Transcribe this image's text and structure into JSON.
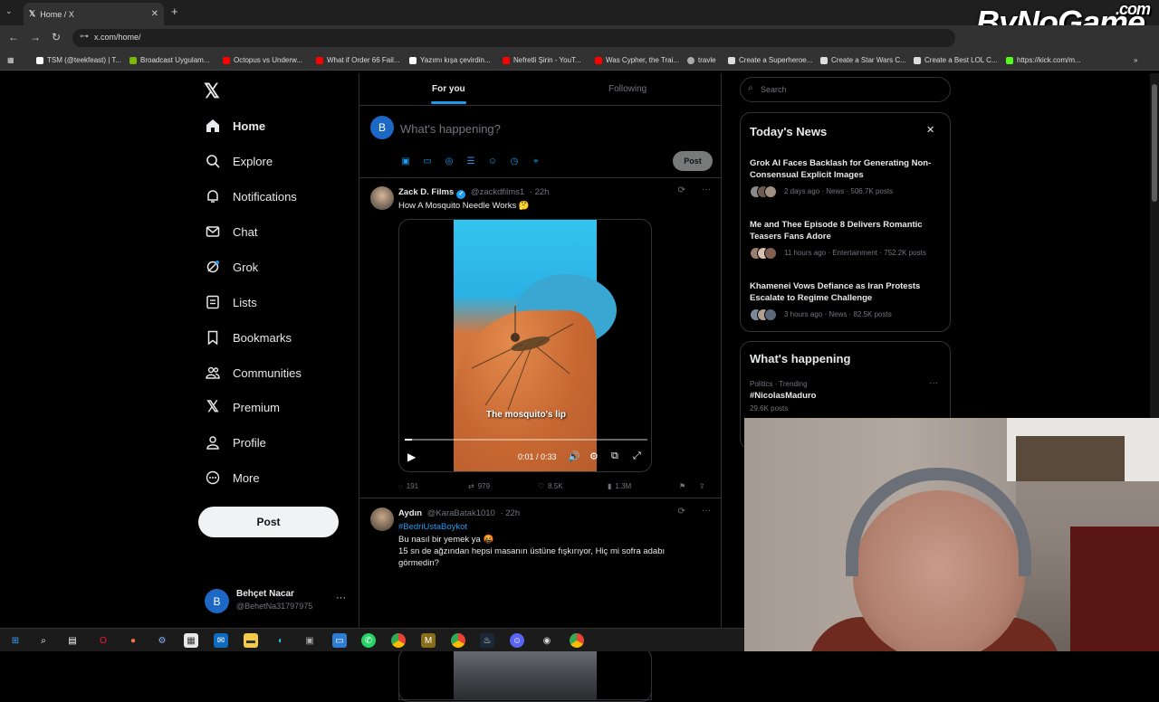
{
  "browser": {
    "tab_title": "Home / X",
    "url": "x.com/home/",
    "bookmarks": [
      "TSM (@teekfeast) | T...",
      "Broadcast Uygulam...",
      "Octopus vs Underw...",
      "What if Order 66 Fail...",
      "Yazımı kışa çevirdin...",
      "Nefretli Şirin - YouT...",
      "Was Cypher, the Trai...",
      "travle",
      "Create a Superheroe...",
      "Create a Star Wars C...",
      "Create a Best LOL C...",
      "https://kick.com/m..."
    ]
  },
  "overlay": {
    "logo": "ByNoGame",
    "logo_suffix": ".com"
  },
  "nav": {
    "items": [
      {
        "label": "Home",
        "icon": "home-icon"
      },
      {
        "label": "Explore",
        "icon": "search-icon"
      },
      {
        "label": "Notifications",
        "icon": "bell-icon"
      },
      {
        "label": "Chat",
        "icon": "mail-icon"
      },
      {
        "label": "Grok",
        "icon": "grok-icon"
      },
      {
        "label": "Lists",
        "icon": "list-icon"
      },
      {
        "label": "Bookmarks",
        "icon": "bookmark-icon"
      },
      {
        "label": "Communities",
        "icon": "people-icon"
      },
      {
        "label": "Premium",
        "icon": "x-icon"
      },
      {
        "label": "Profile",
        "icon": "person-icon"
      },
      {
        "label": "More",
        "icon": "more-circle-icon"
      }
    ],
    "post_label": "Post",
    "account": {
      "initial": "B",
      "name": "Behçet Nacar",
      "handle": "@BehetNa31797975"
    }
  },
  "feed": {
    "tabs": [
      "For you",
      "Following"
    ],
    "compose": {
      "initial": "B",
      "placeholder": "What's happening?",
      "post_label": "Post"
    },
    "tweets": [
      {
        "name": "Zack D. Films",
        "handle": "@zackdfilms1",
        "time": "· 22h",
        "text": "How A Mosquito Needle Works 🤔",
        "video": {
          "caption": "The mosquito's lip",
          "time": "0:01 / 0:33",
          "progress": 0.03
        },
        "replies": "191",
        "reposts": "979",
        "likes": "8.5K",
        "views": "1.3M"
      },
      {
        "name": "Aydın",
        "handle": "@KaraBatak1010",
        "time": "· 22h",
        "hashtag": "#BedriUstaBoykot",
        "line1": "Bu nasıl bir yemek ya 🤬",
        "line2": "15 sn de ağzından hepsi masanın üstüne fışkırıyor, Hiç mi sofra adabı",
        "line3": "görmedin?"
      }
    ]
  },
  "sidebar": {
    "search_placeholder": "Search",
    "news_title": "Today's News",
    "news": [
      {
        "title": "Grok AI Faces Backlash for Generating Non-Consensual Explicit Images",
        "meta": "2 days ago · News · 506.7K posts"
      },
      {
        "title": "Me and Thee Episode 8 Delivers Romantic Teasers Fans Adore",
        "meta": "11 hours ago · Entertainment · 752.2K posts"
      },
      {
        "title": "Khamenei Vows Defiance as Iran Protests Escalate to Regime Challenge",
        "meta": "3 hours ago · News · 82.5K posts"
      }
    ],
    "happening_title": "What's happening",
    "trend": {
      "category": "Politics · Trending",
      "name": "#NicolasMaduro",
      "count": "29.6K posts"
    }
  },
  "colors": {
    "accent": "#1d9bf0",
    "background": "#000000",
    "border": "#2f3336",
    "muted": "#71767b"
  }
}
